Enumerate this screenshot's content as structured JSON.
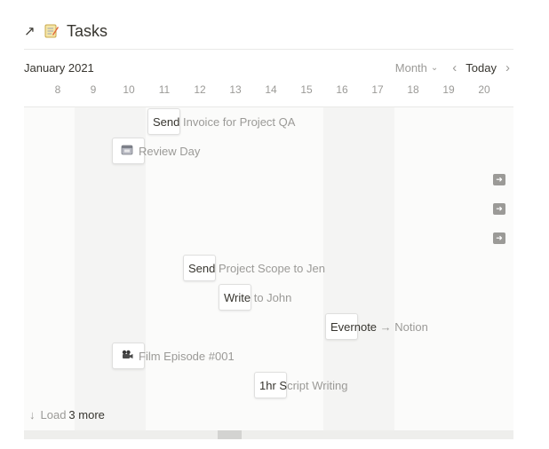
{
  "header": {
    "open_icon": "arrow-up-left-icon",
    "page_icon": "memo-icon",
    "title": "Tasks"
  },
  "toolbar": {
    "month": "January 2021",
    "view": "Month",
    "today": "Today",
    "prev_icon": "chevron-left-icon",
    "next_icon": "chevron-right-icon"
  },
  "days": [
    "8",
    "9",
    "10",
    "11",
    "12",
    "13",
    "14",
    "15",
    "16",
    "17",
    "18",
    "19",
    "20"
  ],
  "tasks": [
    {
      "prefix": "Send",
      "rest": " Invoice for Project QA",
      "icon": ""
    },
    {
      "prefix": "",
      "rest": "Review Day",
      "icon": "calendar-icon"
    },
    {
      "prefix": "Send",
      "rest": " Project Scope to Jen",
      "icon": ""
    },
    {
      "prefix": "Write",
      "rest": " to John",
      "icon": ""
    },
    {
      "prefix": "Evernote",
      "rest": " → Notion",
      "icon": ""
    },
    {
      "prefix": "",
      "rest": "Film Episode #001",
      "icon": "movie-camera-icon"
    },
    {
      "prefix": "1hr S",
      "rest": "cript Writing",
      "icon": ""
    }
  ],
  "offscreen_icon": "arrow-right-icon",
  "load_more": {
    "prefix": "Load",
    "count_text": "3 more"
  },
  "colors": {
    "text": "#37352f",
    "muted": "#9b9a97",
    "shade": "#f4f4f3",
    "background": "#fbfbfa"
  }
}
